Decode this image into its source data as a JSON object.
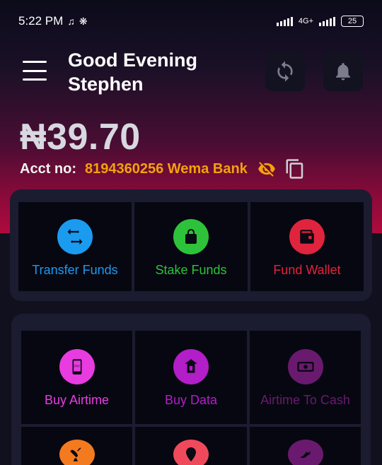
{
  "status": {
    "time": "5:22 PM",
    "network": "4G+",
    "battery": "25"
  },
  "header": {
    "greeting_line1": "Good Evening",
    "greeting_line2": "Stephen"
  },
  "account": {
    "balance": "₦39.70",
    "acct_label": "Acct no:",
    "acct_number": "8194360256 Wema Bank"
  },
  "colors": {
    "accent_orange": "#f5a10c",
    "transfer_blue": "#1a9bf0",
    "stake_green": "#2ec23a",
    "fund_red": "#e0243d",
    "airtime_pink": "#e83ce0",
    "data_purple": "#b21ec8",
    "airtime_cash_purple": "#6a1a6e",
    "cable_orange": "#f47a1f",
    "coral": "#ef4a5c"
  },
  "quick_actions": [
    {
      "label": "Transfer Funds",
      "icon": "transfer-icon"
    },
    {
      "label": "Stake Funds",
      "icon": "lock-icon"
    },
    {
      "label": "Fund Wallet",
      "icon": "wallet-icon"
    }
  ],
  "services": [
    {
      "label": "Buy Airtime",
      "icon": "pay-phone-icon"
    },
    {
      "label": "Buy Data",
      "icon": "data-icon"
    },
    {
      "label": "Airtime To Cash",
      "icon": "cash-icon"
    }
  ],
  "services_row2": [
    {
      "icon": "satellite-dish-icon"
    },
    {
      "icon": "location-pin-icon"
    },
    {
      "icon": "bird-icon"
    }
  ]
}
